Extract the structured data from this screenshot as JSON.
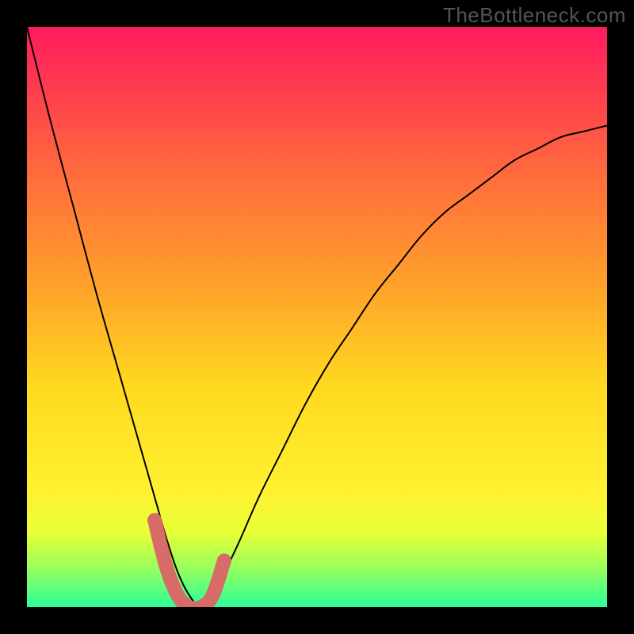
{
  "watermark": "TheBottleneck.com",
  "chart_data": {
    "type": "line",
    "title": "",
    "xlabel": "",
    "ylabel": "",
    "xlim": [
      0,
      100
    ],
    "ylim": [
      0,
      100
    ],
    "series": [
      {
        "name": "bottleneck-curve",
        "x": [
          0,
          4,
          8,
          12,
          16,
          20,
          22,
          24,
          26,
          28,
          30,
          32,
          36,
          40,
          44,
          48,
          52,
          56,
          60,
          64,
          68,
          72,
          76,
          80,
          84,
          88,
          92,
          96,
          100
        ],
        "values": [
          100,
          84,
          69,
          54,
          40,
          26,
          19,
          12,
          6,
          2,
          0,
          2,
          10,
          19,
          27,
          35,
          42,
          48,
          54,
          59,
          64,
          68,
          71,
          74,
          77,
          79,
          81,
          82,
          83
        ]
      },
      {
        "name": "bottom-highlight",
        "x": [
          22,
          24,
          26,
          28,
          30,
          32,
          34
        ],
        "values": [
          15,
          7,
          2,
          0,
          0,
          2,
          8
        ]
      }
    ],
    "annotations": []
  }
}
